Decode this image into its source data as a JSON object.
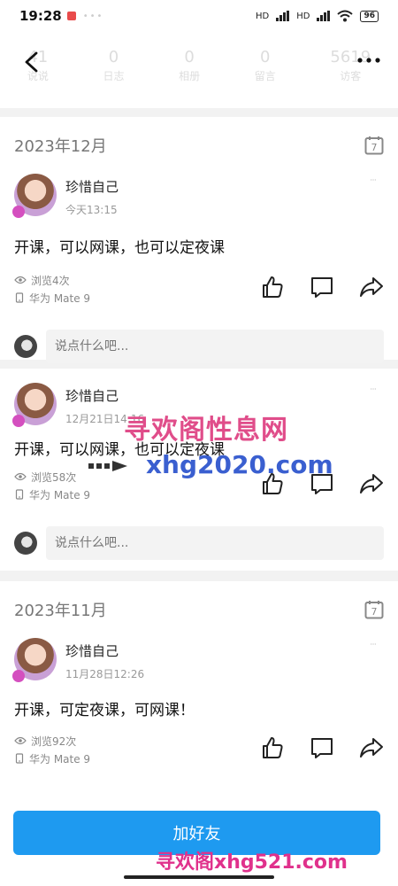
{
  "status": {
    "time": "19:28",
    "battery": "96",
    "net1": "HD",
    "net2": "HD"
  },
  "profile_stats": [
    {
      "value": "41",
      "label": "说说"
    },
    {
      "value": "0",
      "label": "日志"
    },
    {
      "value": "0",
      "label": "相册"
    },
    {
      "value": "0",
      "label": "留言"
    },
    {
      "value": "5619",
      "label": "访客"
    }
  ],
  "groups": [
    {
      "month": "2023年12月",
      "posts": [
        {
          "author": "珍惜自己",
          "time": "今天13:15",
          "text": "开课，可以网课，也可以定夜课",
          "views": "浏览4次",
          "device": "华为 Mate 9",
          "comment_placeholder": "说点什么吧..."
        },
        {
          "author": "珍惜自己",
          "time": "12月21日14:16",
          "text": "开课，可以网课，也可以定夜课",
          "views": "浏览58次",
          "device": "华为 Mate 9",
          "comment_placeholder": "说点什么吧..."
        }
      ]
    },
    {
      "month": "2023年11月",
      "posts": [
        {
          "author": "珍惜自己",
          "time": "11月28日12:26",
          "text": "开课，可定夜课，可网课！",
          "views": "浏览92次",
          "device": "华为 Mate 9"
        }
      ]
    }
  ],
  "add_friend_label": "加好友",
  "calendar_day": "7",
  "watermarks": {
    "top": "寻欢阁性息网",
    "middle": "xhg2020.com",
    "bottom": "寻欢阁xhg521.com"
  }
}
